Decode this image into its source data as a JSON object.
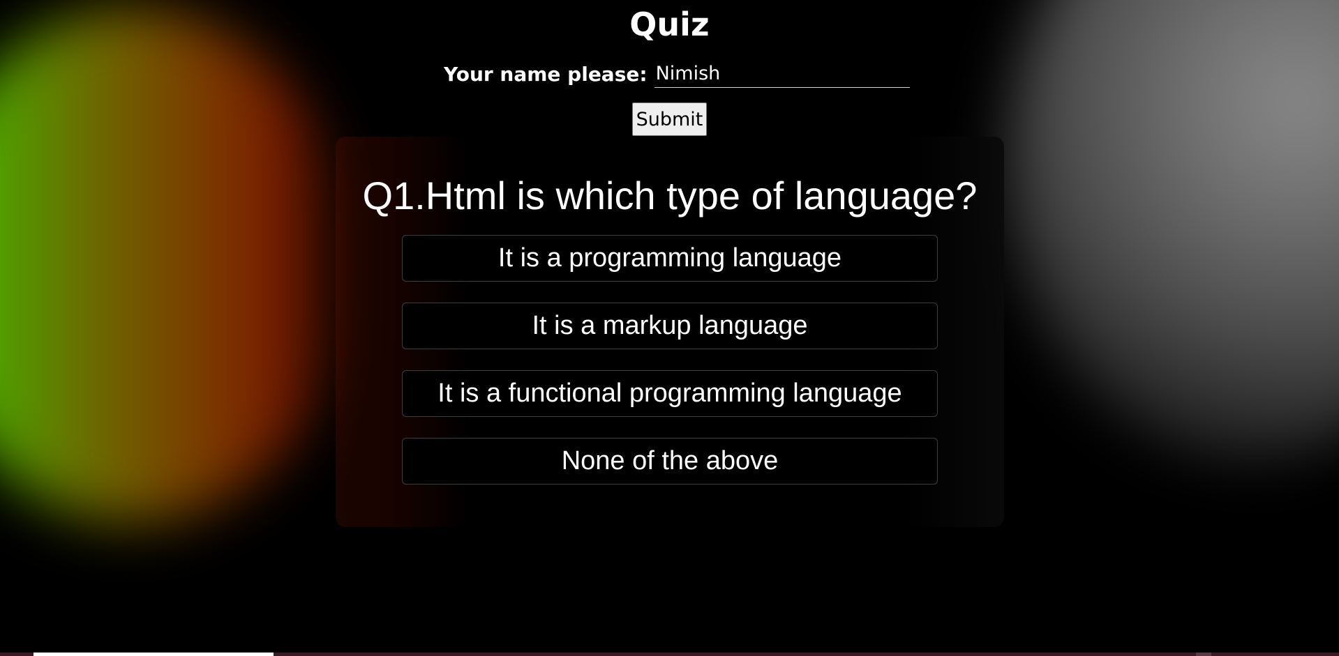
{
  "header": {
    "title": "Quiz"
  },
  "name_form": {
    "label": "Your name please:",
    "value": "Nimish",
    "submit_label": "Submit"
  },
  "quiz": {
    "question": "Q1.Html is which type of language?",
    "options": [
      "It is a programming language",
      "It is a markup language",
      "It is a functional programming language",
      "None of the above"
    ]
  },
  "colors": {
    "background": "#000000",
    "left_glow_green": "#5cc300",
    "left_glow_red": "#7a1a00",
    "right_glow_gray": "#8a8a8a",
    "option_border": "#3d3d3d",
    "submit_background": "#efefef"
  }
}
